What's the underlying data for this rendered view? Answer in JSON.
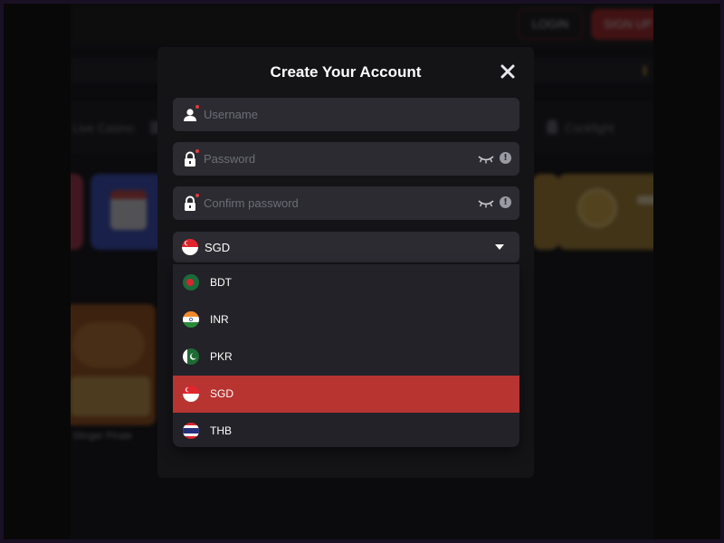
{
  "background_site": {
    "header": {
      "login_label": "LOGIN",
      "signup_label": "SIGN UP"
    },
    "nav": {
      "live_casino_label": "Live Casino",
      "cockfight_label": "Cockfight"
    },
    "game_caption": "Slinger Pirate"
  },
  "modal": {
    "title": "Create Your Account",
    "username": {
      "placeholder": "Username",
      "icon": "user-icon"
    },
    "password": {
      "placeholder": "Password",
      "icon": "lock-icon"
    },
    "confirm_password": {
      "placeholder": "Confirm password",
      "icon": "lock-icon"
    },
    "info_glyph": "!",
    "currency": {
      "selected": "SGD",
      "options": [
        {
          "code": "BDT",
          "flag": "bangladesh-flag"
        },
        {
          "code": "INR",
          "flag": "india-flag"
        },
        {
          "code": "PKR",
          "flag": "pakistan-flag"
        },
        {
          "code": "SGD",
          "flag": "singapore-flag"
        },
        {
          "code": "THB",
          "flag": "thailand-flag"
        }
      ]
    }
  },
  "colors": {
    "accent": "#b73431",
    "modal_bg": "#141417",
    "field_bg": "#2b2b31",
    "dropdown_bg": "#222228"
  }
}
